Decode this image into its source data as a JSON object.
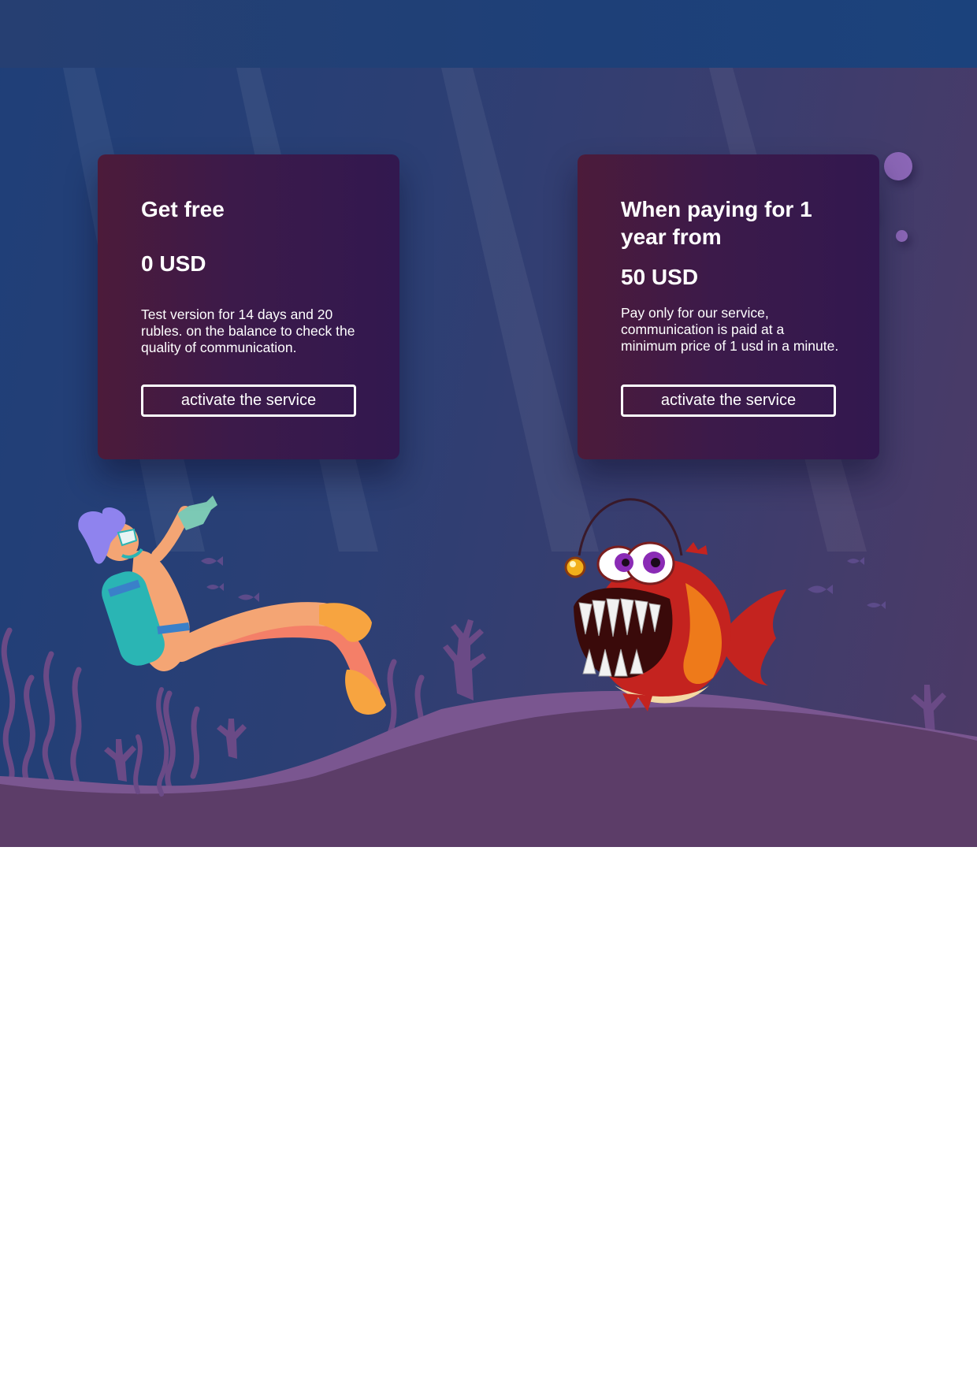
{
  "plans": [
    {
      "title": "Get free",
      "price": "0 USD",
      "description": "Test version for 14 days and 20 rubles. on the balance to check the quality of communication.",
      "button_label": "activate the service"
    },
    {
      "title": "When paying for 1 year from",
      "price": "50 USD",
      "description": "Pay only for our service, communication is paid at a minimum price of 1 usd in a minute.",
      "button_label": "activate the service"
    }
  ],
  "colors": {
    "sea_top": "#1f3f78",
    "sea_right": "#4d3a66",
    "card_left": "#4c1b3a",
    "card_right": "#32184f",
    "seabed": "#5c3d68",
    "seabed_hill": "#7a5690",
    "bubble": "#8b66b6",
    "button_border": "#ffffff"
  },
  "illustrations": [
    "scuba-diver-illustration",
    "anglerfish-illustration",
    "seaweed-illustration",
    "coral-illustration",
    "small-fish-illustration"
  ]
}
